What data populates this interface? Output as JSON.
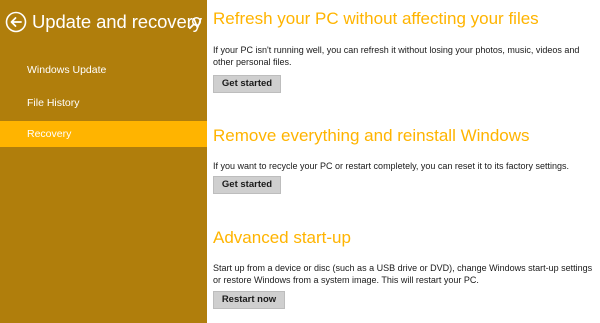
{
  "sidebar": {
    "title": "Update and recovery",
    "back_icon": "back-arrow-icon",
    "search_icon": "search-icon",
    "items": [
      {
        "label": "Windows Update",
        "active": false
      },
      {
        "label": "File History",
        "active": false
      },
      {
        "label": "Recovery",
        "active": true
      }
    ]
  },
  "main": {
    "sections": [
      {
        "title": "Refresh your PC without affecting your files",
        "description": "If your PC isn't running well, you can refresh it without losing your photos, music, videos and other personal files.",
        "button": "Get started"
      },
      {
        "title": "Remove everything and reinstall Windows",
        "description": "If you want to recycle your PC or restart completely, you can reset it to its factory settings.",
        "button": "Get started"
      },
      {
        "title": "Advanced start-up",
        "description": "Start up from a device or disc (such as a USB drive or DVD), change Windows start-up settings or restore Windows from a system image. This will restart your PC.",
        "button": "Restart now"
      }
    ]
  },
  "colors": {
    "sidebar_bg": "#b07e0c",
    "accent": "#ffb400",
    "button_bg": "#cfcfcf"
  }
}
